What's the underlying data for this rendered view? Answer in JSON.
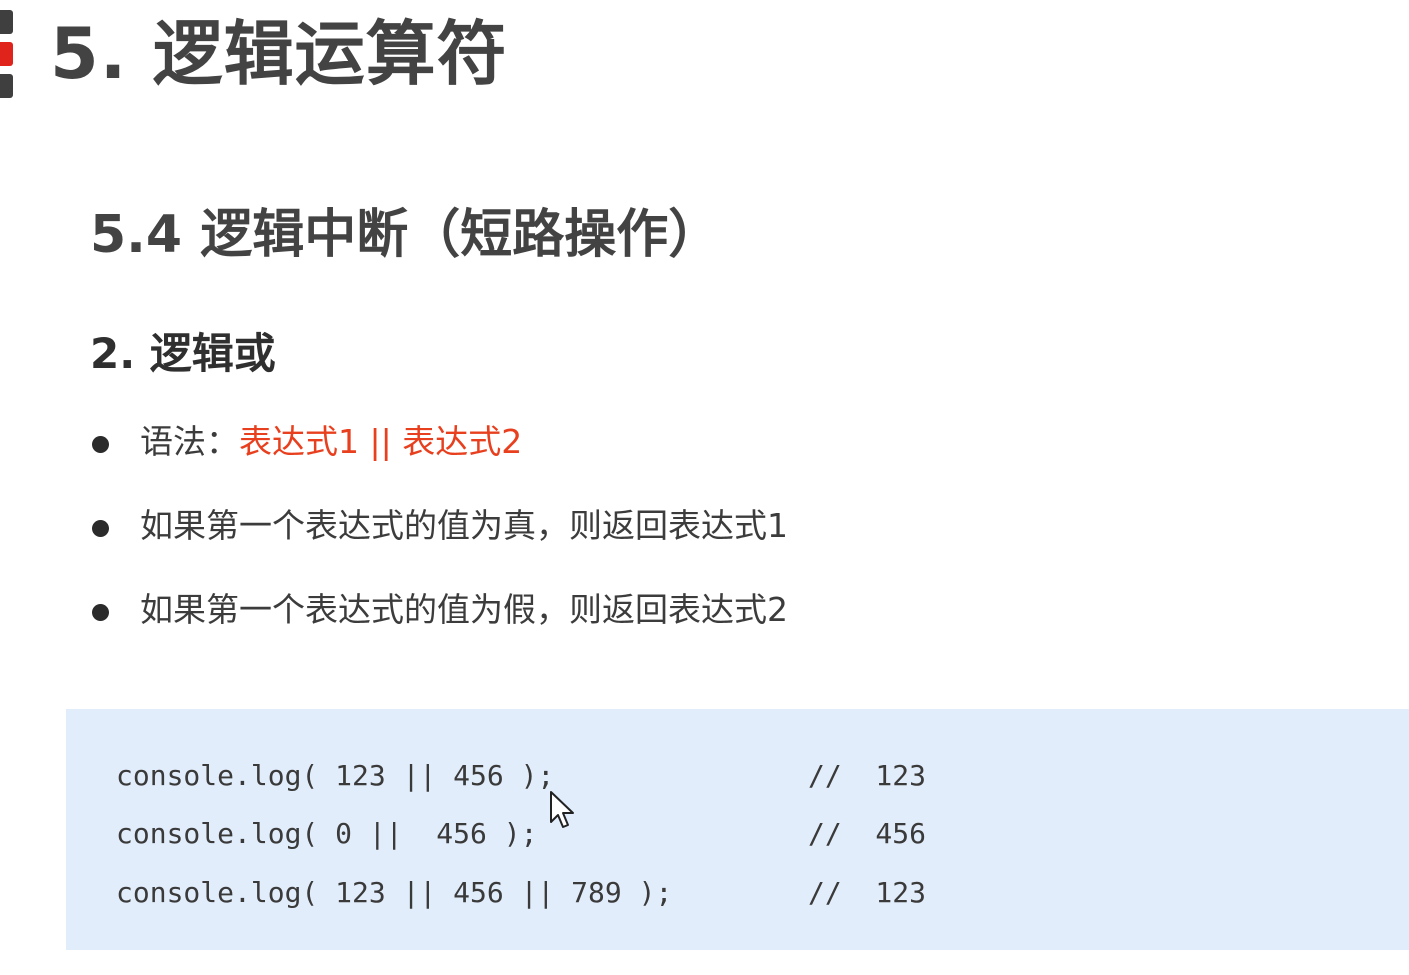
{
  "page": {
    "title": "5. 逻辑运算符"
  },
  "section": {
    "title": "5.4 逻辑中断（短路操作）"
  },
  "subsection": {
    "title": "2. 逻辑或"
  },
  "bullets": {
    "syntax_label": "语法：",
    "syntax_expression": "表达式1 || 表达式2",
    "item_true": "如果第一个表达式的值为真，则返回表达式1",
    "item_false": "如果第一个表达式的值为假，则返回表达式2"
  },
  "code": {
    "lines": [
      {
        "code": "console.log( 123 || 456 );",
        "comment": "//  123"
      },
      {
        "code": "console.log( 0 ||  456 );",
        "comment": "//  456"
      },
      {
        "code": "console.log( 123 || 456 || 789 );",
        "comment": "//  123"
      }
    ]
  },
  "colors": {
    "accent_red": "#e0231b",
    "expression_red": "#e8401f",
    "heading_gray": "#434343",
    "code_background": "#e2edfb"
  },
  "icons": {
    "heading_marker": "section-marker-icon",
    "bullet": "bullet-dot-icon",
    "cursor": "mouse-pointer-icon"
  }
}
